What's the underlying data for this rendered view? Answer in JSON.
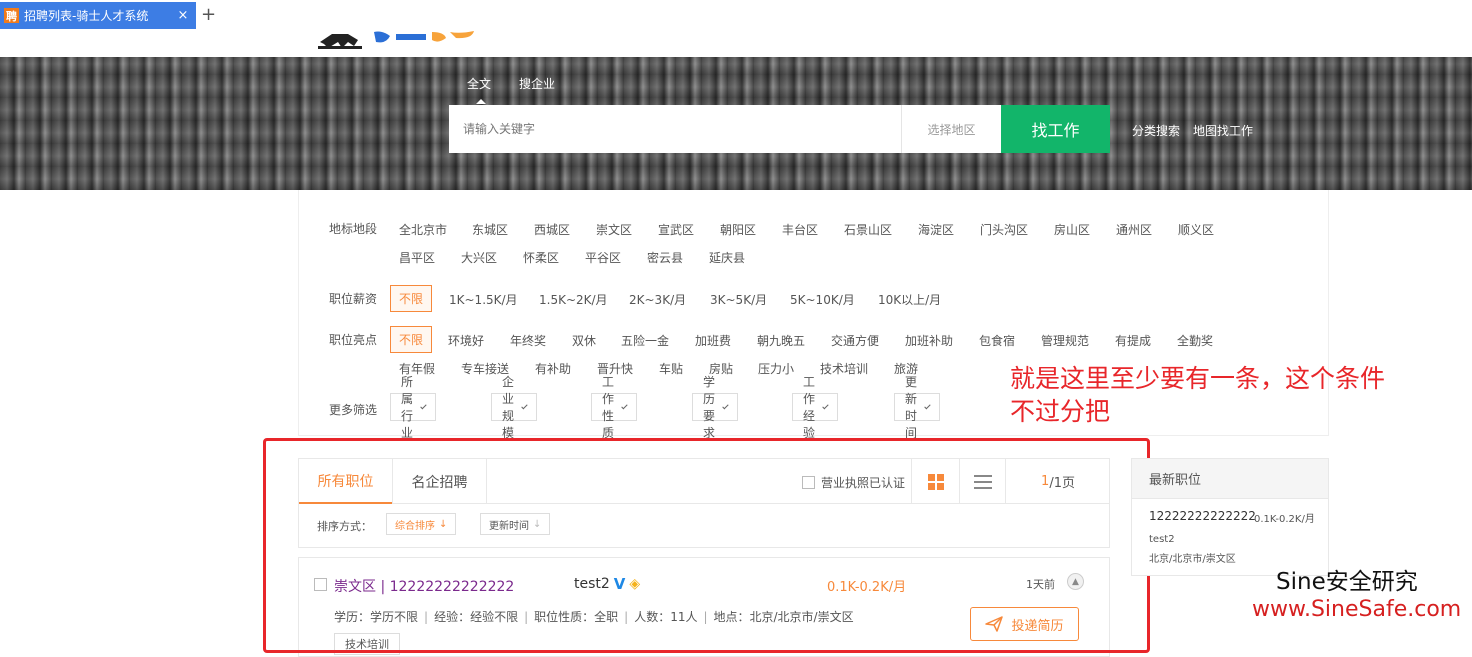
{
  "browser": {
    "tab_title": "招聘列表-骑士人才系统",
    "favicon_char": "聘",
    "close_symbol": "×",
    "new_tab_symbol": "+",
    "tab_color": "#3d7de4"
  },
  "hero": {
    "search_tabs": [
      "全文",
      "搜企业"
    ],
    "search_placeholder": "请输入关键字",
    "region_placeholder": "选择地区",
    "search_button": "找工作",
    "links": [
      "分类搜索",
      "地图找工作"
    ],
    "button_color": "#12b56a"
  },
  "filters": {
    "district_label": "地标地段",
    "districts": [
      "全北京市",
      "东城区",
      "西城区",
      "崇文区",
      "宣武区",
      "朝阳区",
      "丰台区",
      "石景山区",
      "海淀区",
      "门头沟区",
      "房山区",
      "通州区",
      "顺义区",
      "昌平区",
      "大兴区",
      "怀柔区",
      "平谷区",
      "密云县",
      "延庆县"
    ],
    "salary_label": "职位薪资",
    "salaries": [
      "不限",
      "1K~1.5K/月",
      "1.5K~2K/月",
      "2K~3K/月",
      "3K~5K/月",
      "5K~10K/月",
      "10K以上/月"
    ],
    "highlight_label": "职位亮点",
    "highlights": [
      "不限",
      "环境好",
      "年终奖",
      "双休",
      "五险一金",
      "加班费",
      "朝九晚五",
      "交通方便",
      "加班补助",
      "包食宿",
      "管理规范",
      "有提成",
      "全勤奖",
      "有年假",
      "专车接送",
      "有补助",
      "晋升快",
      "车贴",
      "房贴",
      "压力小",
      "技术培训",
      "旅游"
    ],
    "more_label": "更多筛选",
    "dropdowns": [
      "所属行业",
      "企业规模",
      "工作性质",
      "学历要求",
      "工作经验",
      "更新时间"
    ],
    "accent": "#f7893b"
  },
  "annotation": {
    "line1": "就是这里至少要有一条，这个条件",
    "line2": "不过分把",
    "color": "#e8262a"
  },
  "list": {
    "tabs": [
      "所有职位",
      "名企招聘"
    ],
    "license_label": "营业执照已认证",
    "page_current": "1",
    "page_total": "/1页",
    "sort_label": "排序方式：",
    "sort_options": [
      "综合排序",
      "更新时间"
    ]
  },
  "job": {
    "title": "崇文区 | 12222222222222",
    "company": "test2",
    "salary": "0.1K-0.2K/月",
    "time": "1天前",
    "meta": [
      "学历：学历不限",
      "经验：经验不限",
      "职位性质：全职",
      "人数：11人",
      "地点：北京/北京市/崇文区"
    ],
    "apply_label": "投递简历",
    "tag": "技术培训"
  },
  "sidebar": {
    "title": "最新职位",
    "job_title": "12222222222222",
    "job_salary": "0.1K-0.2K/月",
    "company": "test2",
    "location": "北京/北京市/崇文区"
  },
  "watermark": {
    "title": "Sine安全研究",
    "url": "www.SineSafe.com"
  }
}
